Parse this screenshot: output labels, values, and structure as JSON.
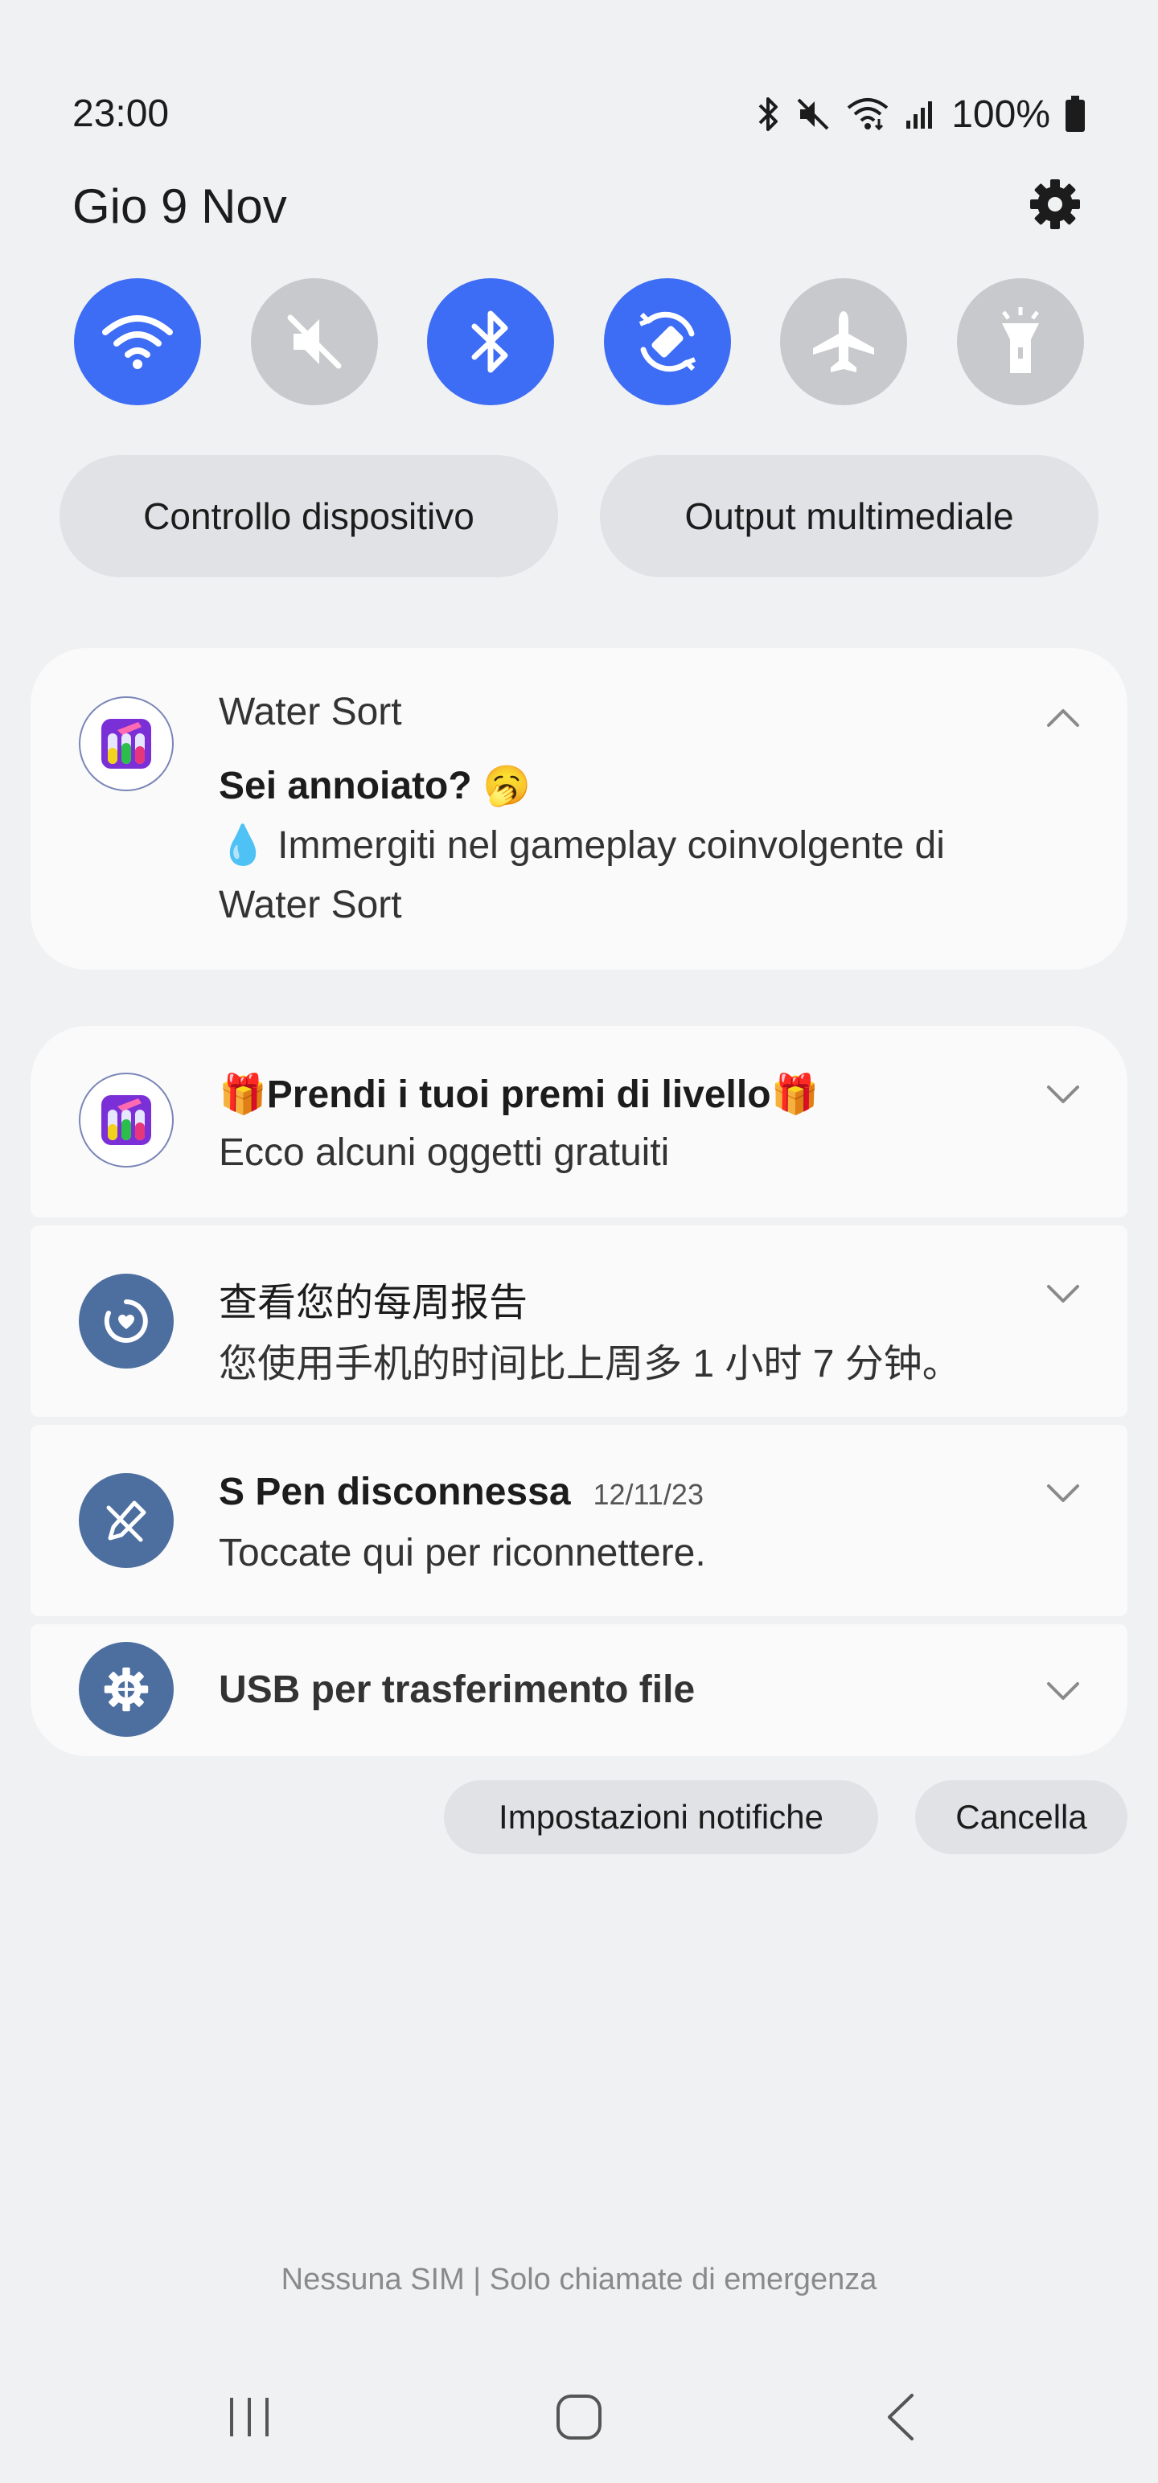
{
  "status_bar": {
    "time": "23:00",
    "battery_percent": "100%",
    "icons": [
      "bluetooth-icon",
      "mute-icon",
      "wifi-icon",
      "signal-icon",
      "battery-icon"
    ]
  },
  "header": {
    "date": "Gio 9 Nov",
    "settings_icon": "gear-icon"
  },
  "quick_toggles": [
    {
      "name": "wifi",
      "icon": "wifi-icon",
      "state": "on"
    },
    {
      "name": "sound",
      "icon": "mute-icon",
      "state": "off"
    },
    {
      "name": "bluetooth",
      "icon": "bluetooth-icon",
      "state": "on"
    },
    {
      "name": "auto-rotate",
      "icon": "rotate-icon",
      "state": "on"
    },
    {
      "name": "airplane-mode",
      "icon": "airplane-icon",
      "state": "off"
    },
    {
      "name": "flashlight",
      "icon": "flashlight-icon",
      "state": "off"
    }
  ],
  "quick_buttons": {
    "device_control": "Controllo dispositivo",
    "media_output": "Output multimediale"
  },
  "notifications": {
    "water_sort": {
      "app_name": "Water Sort",
      "title": "Sei annoiato? 🥱",
      "body_line1": "💧 Immergiti nel gameplay coinvolgente di",
      "body_line2": "Water Sort"
    },
    "prizes": {
      "title": "🎁Prendi i tuoi premi di livello🎁",
      "body": "Ecco alcuni oggetti gratuiti"
    },
    "weekly_report": {
      "title": "查看您的每周报告",
      "body": "您使用手机的时间比上周多 1 小时 7 分钟。"
    },
    "spen": {
      "title": "S Pen disconnessa",
      "time": "12/11/23",
      "body": "Toccate qui per riconnettere."
    },
    "usb": {
      "title": "USB per trasferimento file"
    }
  },
  "actions": {
    "notification_settings": "Impostazioni notifiche",
    "clear": "Cancella"
  },
  "footer": {
    "sim_status": "Nessuna SIM | Solo chiamate di emergenza"
  },
  "colors": {
    "accent": "#3d6cf5",
    "toggle_off": "#c8c9cc",
    "background": "#f0f1f3",
    "card": "#fafafa",
    "system_icon_bg": "#4d6fa0"
  }
}
